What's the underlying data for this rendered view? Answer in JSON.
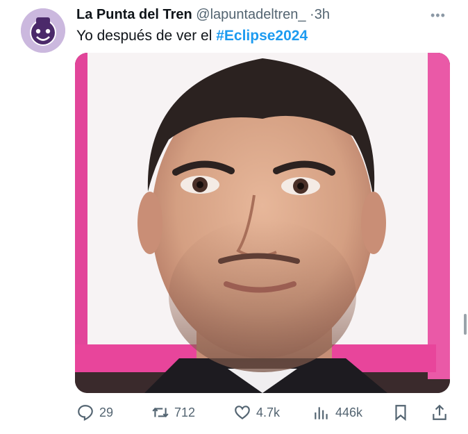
{
  "tweet": {
    "author_name": "La Punta del Tren",
    "handle": "@lapuntadeltren_",
    "separator": "·",
    "time": "3h",
    "more_icon": "more-icon",
    "text_prefix": "Yo después de ver el ",
    "hashtag": "#Eclipse2024",
    "hashtag_color": "#1d9bf0",
    "media_description": "photo"
  },
  "actions": {
    "replies": "29",
    "retweets": "712",
    "likes": "4.7k",
    "views": "446k",
    "reply_icon": "reply-icon",
    "retweet_icon": "retweet-icon",
    "like_icon": "heart-icon",
    "views_icon": "bar-chart-icon",
    "bookmark_icon": "bookmark-icon",
    "share_icon": "share-icon"
  },
  "colors": {
    "text": "#0f1419",
    "muted": "#536471",
    "frame_pink": "#e83e9a",
    "avatar_bg": "#c9b6dc"
  }
}
